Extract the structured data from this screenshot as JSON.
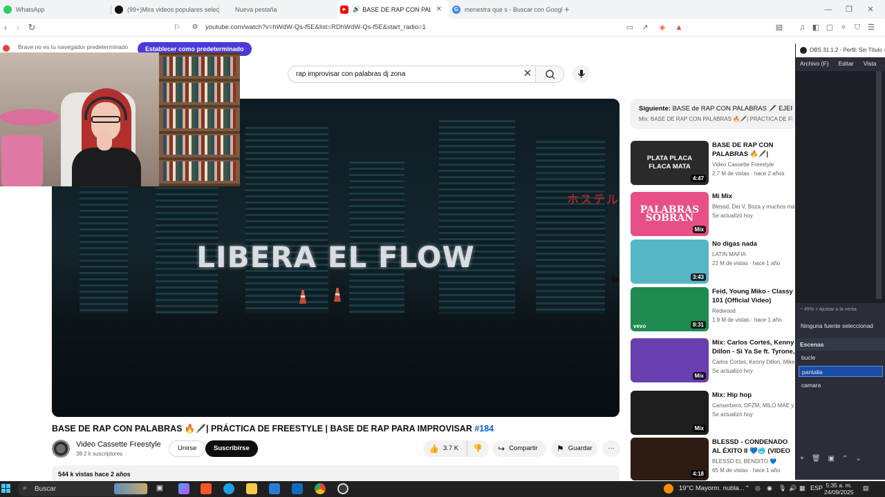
{
  "browser": {
    "tabs": [
      {
        "label": "WhatsApp",
        "fav_color": "#25d366"
      },
      {
        "label": "(99+)Mira videos populares selecci",
        "fav_color": "#111111"
      },
      {
        "label": "Nueva pestaña",
        "fav_color": "#f1f3f4"
      },
      {
        "label": "BASE DE RAP CON PALABRA",
        "fav_color": "#ff0000",
        "active": true
      },
      {
        "label": "menestra que s - Buscar con Google",
        "fav_color": "#4285f4"
      }
    ],
    "new_tab": "+",
    "url": "youtube.com/watch?v=hWdW-Qs-f5E&list=RDhWdW-Qs-f5E&start_radio=1",
    "infobar_text": "Brave no es tu navegador predeterminado",
    "infobar_button": "Establecer como predeterminado"
  },
  "youtube": {
    "search_value": "rap improvisar con palabras dj zona",
    "player_overlay_text": "LIBERA EL FLOW",
    "neon_sign": "ホステル",
    "video_title": "BASE DE RAP CON PALABRAS 🔥🖋️| PRÁCTICA DE FREESTYLE | BASE DE RAP PARA IMPROVISAR",
    "video_tag": "#184",
    "channel_name": "Video Cassette Freestyle",
    "channel_subs": "38.2 k suscriptores",
    "join_label": "Unirse",
    "subscribe_label": "Suscribirse",
    "likes": "3.7 K",
    "share_label": "Compartir",
    "save_label": "Guardar",
    "more_label": "···",
    "desc_views": "544 k vistas  hace 2 años"
  },
  "sidebar": {
    "next_prefix": "Siguiente:",
    "next_title": "BASE de RAP CON PALABRAS 🖋️ EJERCI...",
    "next_sub": "Mix: BASE DE RAP CON PALABRAS 🔥🖋️| PRÁCTICA DE FR...",
    "recs": [
      {
        "title": "BASE DE RAP CON PALABRAS 🔥🖋️| PRÁCTICA DE ...",
        "channel": "Video Cassette Freestyle",
        "meta": "2.7 M de vistas · hace 2 años",
        "badge": "4:47",
        "thumb_text": "PLATA PLACA FLACA MATA",
        "thumb_color": "#2a2a2a"
      },
      {
        "title": "Mi Mix",
        "channel": "Blessd, Dei V, Boza y muchos más",
        "meta": "Se actualizó hoy",
        "badge": "Mix",
        "thumb_text": "PALABRAS SOBRAN",
        "thumb_color": "#e84f86"
      },
      {
        "title": "No digas nada",
        "channel": "LATIN MAFIA",
        "meta": "22 M de vistas · hace 1 año",
        "badge": "3:43",
        "thumb_text": "",
        "thumb_color": "#55b7c4"
      },
      {
        "title": "Feid, Young Miko - Classy 101 (Official Video)",
        "channel": "Redwood",
        "meta": "1.9 M de vistas · hace 1 año",
        "badge": "8:31",
        "thumb_text": "vevo",
        "thumb_color": "#1f8a4f"
      },
      {
        "title": "Mix: Carlos Corteś, Kenny Dillon - Si Ya Se ft. Tyrone, Sebas",
        "channel": "Carlos Corteś, Kenny Dillon, Mike D...",
        "meta": "Se actualizó hoy",
        "badge": "Mix",
        "thumb_text": "",
        "thumb_color": "#6a3fb0"
      },
      {
        "title": "Mix: Hip hop",
        "channel": "Canserbero, DFZM, MILO MAE y más",
        "meta": "Se actualizó hoy",
        "badge": "Mix",
        "thumb_text": "",
        "thumb_color": "#1e1e1e"
      },
      {
        "title": "BLESSD - CONDENADO AL ÉXITO II 💙🥶 (VIDEO OFICIAL)",
        "channel": "BLESSD EL BENDITO 💙",
        "meta": "65 M de vistas · hace 1 año",
        "badge": "4:18",
        "thumb_text": "",
        "thumb_color": "#2d1b14"
      }
    ]
  },
  "obs": {
    "title": "OBS 31.1.2 - Perfil: Sin Título -",
    "menu": [
      "Archivo (F)",
      "Editar",
      "Vista",
      "P"
    ],
    "zoom": "−   45%   +     Ajustar a la venta",
    "no_source": "Ninguna fuente seleccionad",
    "scenes_header": "Escenas",
    "scenes": [
      {
        "name": "bucle",
        "selected": false
      },
      {
        "name": "pantalla",
        "selected": true
      },
      {
        "name": "camara",
        "selected": false
      }
    ],
    "tools": [
      "+",
      "🗑",
      "▣",
      "⌃",
      "⌄"
    ]
  },
  "taskbar": {
    "search_label": "Buscar",
    "weather": "19°C  Mayorm. nubla...",
    "lang": "ESP",
    "time": "5:35 a. m.",
    "date": "24/09/2025"
  },
  "colors": {
    "youtube_red": "#ff0000",
    "link_blue": "#065fd4",
    "brave_purple": "#4b3ad8",
    "obs_bg": "#2b2e38"
  }
}
